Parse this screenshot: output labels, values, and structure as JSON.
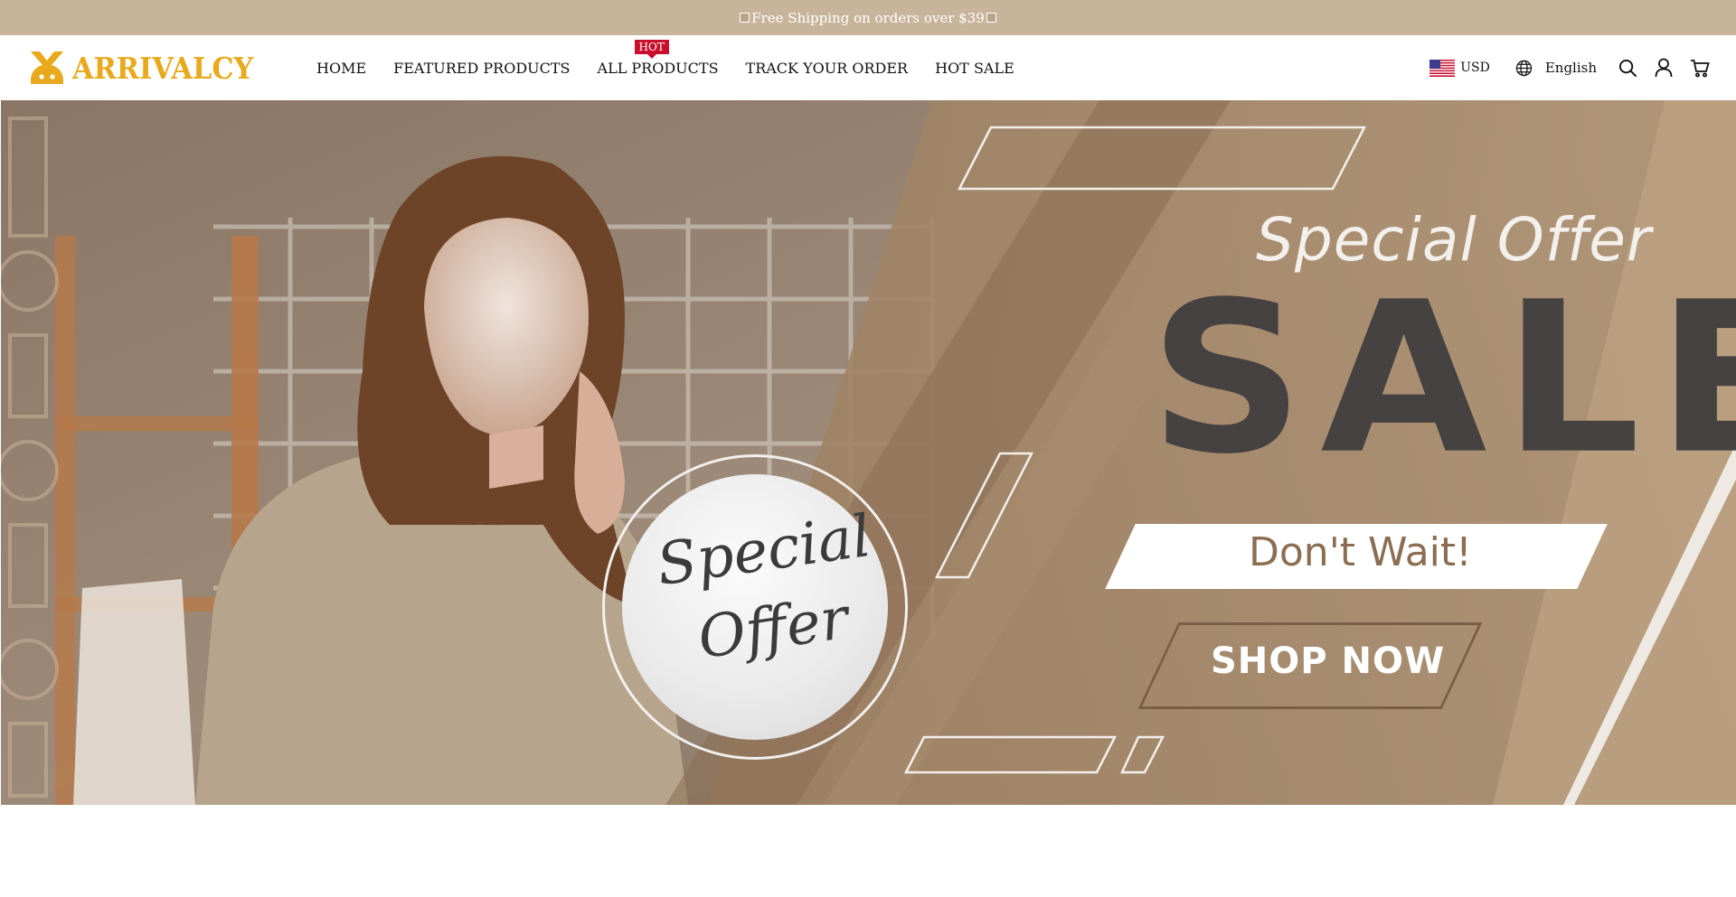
{
  "announcement": {
    "text": "Free Shipping on orders over $39"
  },
  "header": {
    "logo_text": "ARRIVALCY",
    "nav": [
      {
        "label": "HOME"
      },
      {
        "label": "FEATURED PRODUCTS"
      },
      {
        "label": "ALL PRODUCTS",
        "badge": "HOT"
      },
      {
        "label": "TRACK YOUR ORDER"
      },
      {
        "label": "HOT SALE"
      }
    ],
    "currency": "USD",
    "language": "English",
    "icons": [
      "search-icon",
      "account-icon",
      "cart-icon"
    ]
  },
  "hero": {
    "headline": "Special Offer",
    "sale_word": "SALE",
    "tagline": "Don't Wait!",
    "cta": "SHOP NOW",
    "badge_line1": "Special",
    "badge_line2": "Offer"
  },
  "colors": {
    "announcement_bg": "#c8b49b",
    "logo": "#e8a91c",
    "hot_badge": "#c8102e",
    "hero_tan": "#a88a6c",
    "sale_text": "#454241"
  }
}
